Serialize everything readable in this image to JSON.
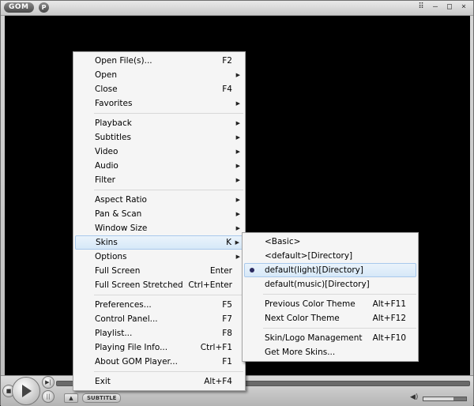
{
  "app": {
    "logo_text": "GOM",
    "logo_badge": "P"
  },
  "window_buttons": [
    "⠿",
    "–",
    "□",
    "×"
  ],
  "controls": {
    "eject_label": "▲",
    "subtitle_label": "SUBTITLE",
    "volume_level": 0.7
  },
  "main_menu": [
    {
      "label": "Open File(s)...",
      "shortcut": "F2"
    },
    {
      "label": "Open",
      "submenu": true
    },
    {
      "label": "Close",
      "shortcut": "F4"
    },
    {
      "label": "Favorites",
      "submenu": true
    },
    {
      "separator": true
    },
    {
      "label": "Playback",
      "submenu": true
    },
    {
      "label": "Subtitles",
      "submenu": true
    },
    {
      "label": "Video",
      "submenu": true
    },
    {
      "label": "Audio",
      "submenu": true
    },
    {
      "label": "Filter",
      "submenu": true
    },
    {
      "separator": true
    },
    {
      "label": "Aspect Ratio",
      "submenu": true
    },
    {
      "label": "Pan & Scan",
      "submenu": true
    },
    {
      "label": "Window Size",
      "submenu": true
    },
    {
      "label": "Skins",
      "shortcut": "K",
      "submenu": true,
      "highlighted": true
    },
    {
      "label": "Options",
      "submenu": true
    },
    {
      "label": "Full Screen",
      "shortcut": "Enter"
    },
    {
      "label": "Full Screen Stretched",
      "shortcut": "Ctrl+Enter"
    },
    {
      "separator": true
    },
    {
      "label": "Preferences...",
      "shortcut": "F5"
    },
    {
      "label": "Control Panel...",
      "shortcut": "F7"
    },
    {
      "label": "Playlist...",
      "shortcut": "F8"
    },
    {
      "label": "Playing File Info...",
      "shortcut": "Ctrl+F1"
    },
    {
      "label": "About GOM Player...",
      "shortcut": "F1"
    },
    {
      "separator": true
    },
    {
      "label": "Exit",
      "shortcut": "Alt+F4"
    }
  ],
  "skins_menu": [
    {
      "label": "<Basic>"
    },
    {
      "label": "<default>[Directory]"
    },
    {
      "label": "default(light)[Directory]",
      "checked": true,
      "highlighted": true
    },
    {
      "label": "default(music)[Directory]"
    },
    {
      "separator": true
    },
    {
      "label": "Previous Color Theme",
      "shortcut": "Alt+F11"
    },
    {
      "label": "Next Color Theme",
      "shortcut": "Alt+F12"
    },
    {
      "separator": true
    },
    {
      "label": "Skin/Logo Management",
      "shortcut": "Alt+F10"
    },
    {
      "label": "Get More Skins..."
    }
  ]
}
